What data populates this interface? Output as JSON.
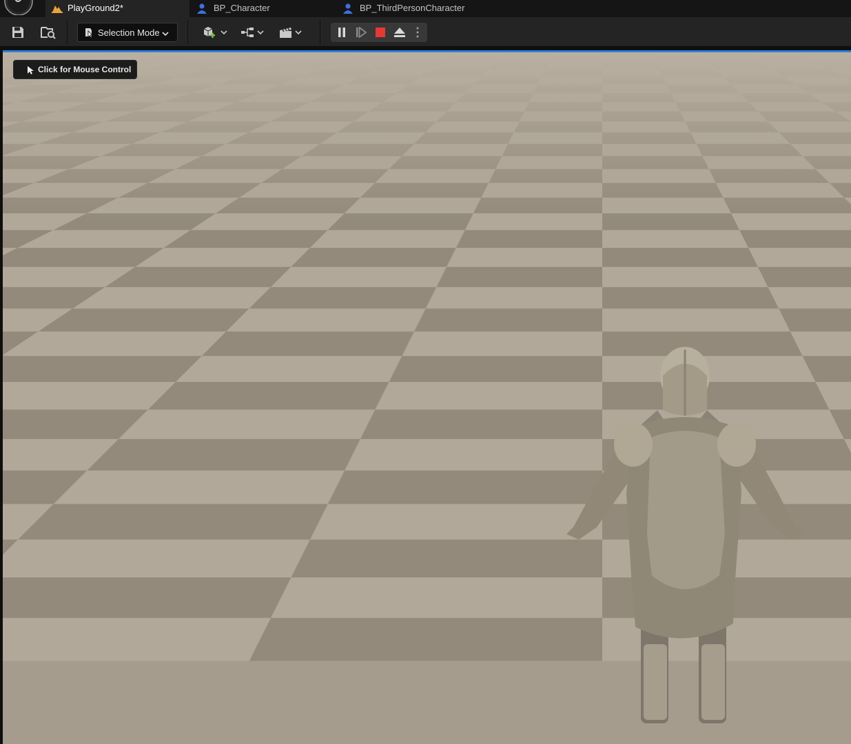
{
  "tabs": [
    {
      "label": "PlayGround2*",
      "icon": "level-icon",
      "active": true
    },
    {
      "label": "BP_Character",
      "icon": "blueprint-character-icon",
      "active": false
    },
    {
      "label": "BP_ThirdPersonCharacter",
      "icon": "blueprint-character-icon",
      "active": false
    }
  ],
  "toolbar": {
    "save_icon": "save-icon",
    "browse_icon": "content-browser-icon",
    "selection_mode": "Selection Mode",
    "quick_add_icon": "quick-add-icon",
    "blueprints_icon": "blueprints-icon",
    "cinematics_icon": "clapperboard-icon",
    "play_controls": [
      "pause-icon",
      "frame-skip-icon",
      "stop-icon",
      "eject-icon",
      "more-options-icon"
    ]
  },
  "viewport": {
    "hint": "Click for Mouse Control",
    "accent_color": "#2f7fd7"
  },
  "colors": {
    "tabbar_bg": "#151515",
    "toolbar_bg": "#242424",
    "stop": "#e53935",
    "level_icon": "#e8a33a",
    "blueprint_icon": "#3f6fe0",
    "quick_add_plus": "#7cc242"
  }
}
